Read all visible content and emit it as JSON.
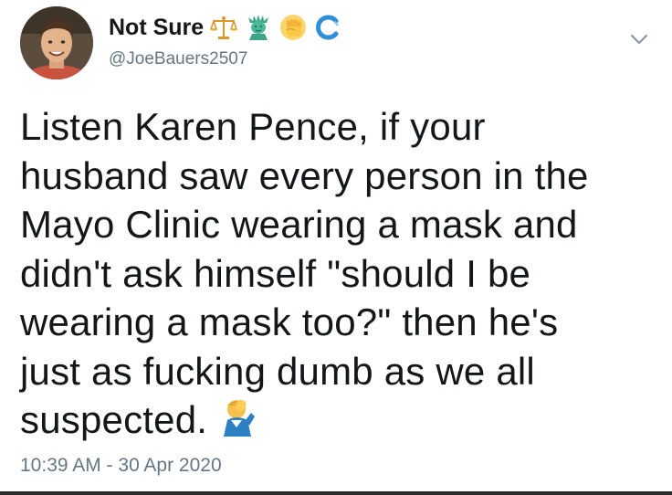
{
  "tweet": {
    "author": {
      "display_name": "Not Sure",
      "handle": "@JoeBauers2507",
      "name_emojis": [
        "scales-icon",
        "statue-of-liberty-icon",
        "raised-fist-icon",
        "wave-icon"
      ]
    },
    "text_lines": [
      "Listen Karen Pence, if your",
      "husband saw every person in the",
      "Mayo Clinic wearing a mask and",
      "didn't ask himself \"should I be",
      "wearing a mask too?\" then he's",
      "just as fucking dumb as we all",
      "suspected."
    ],
    "trailing_emoji": "facepalm-icon",
    "timestamp": "10:39 AM - 30 Apr 2020"
  },
  "colors": {
    "text": "#14171a",
    "secondary": "#657786",
    "background": "#ffffff"
  }
}
